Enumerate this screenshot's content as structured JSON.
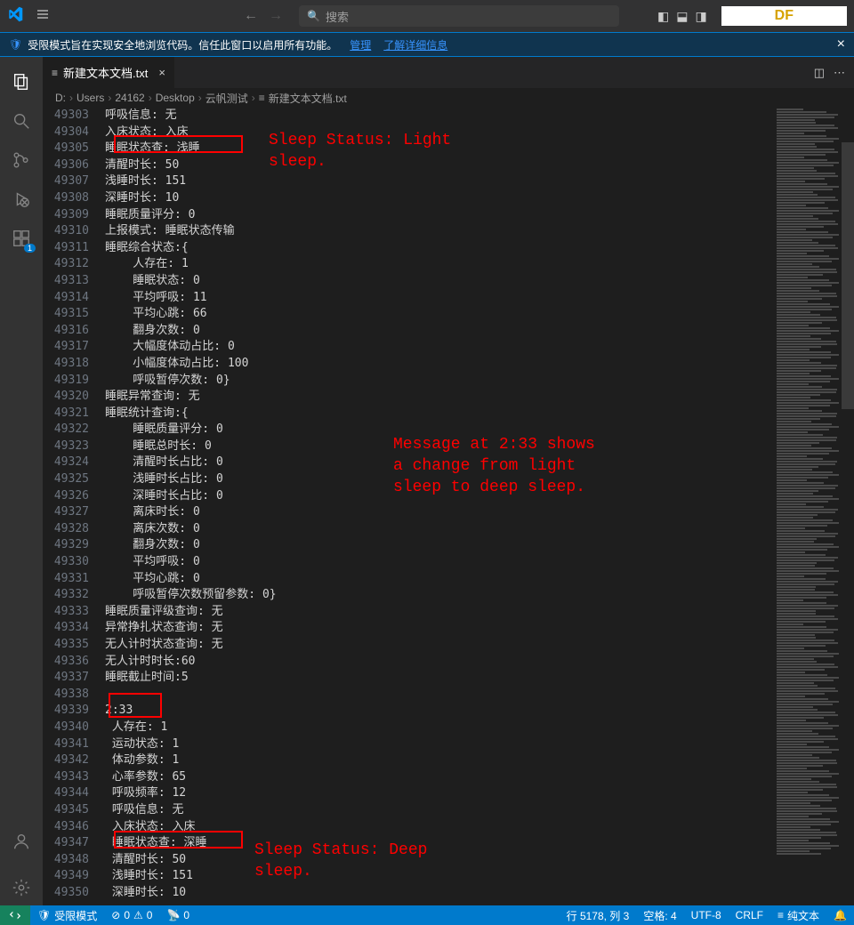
{
  "titlebar": {
    "search_placeholder": "搜索",
    "df_label": "DF"
  },
  "banner": {
    "text": "受限模式旨在实现安全地浏览代码。信任此窗口以启用所有功能。",
    "manage": "管理",
    "learn_more": "了解详细信息"
  },
  "tab": {
    "filename": "新建文本文档.txt"
  },
  "breadcrumbs": [
    "D:",
    "Users",
    "24162",
    "Desktop",
    "云帆测试",
    "新建文本文档.txt"
  ],
  "lines": [
    {
      "n": "49303",
      "t": "呼吸信息: 无"
    },
    {
      "n": "49304",
      "t": "入床状态: 入床"
    },
    {
      "n": "49305",
      "t": "睡眠状态查: 浅睡"
    },
    {
      "n": "49306",
      "t": "清醒时长: 50"
    },
    {
      "n": "49307",
      "t": "浅睡时长: 151"
    },
    {
      "n": "49308",
      "t": "深睡时长: 10"
    },
    {
      "n": "49309",
      "t": "睡眠质量评分: 0"
    },
    {
      "n": "49310",
      "t": "上报模式: 睡眠状态传输"
    },
    {
      "n": "49311",
      "t": "睡眠综合状态:{"
    },
    {
      "n": "49312",
      "t": "    人存在: 1"
    },
    {
      "n": "49313",
      "t": "    睡眠状态: 0"
    },
    {
      "n": "49314",
      "t": "    平均呼吸: 11"
    },
    {
      "n": "49315",
      "t": "    平均心跳: 66"
    },
    {
      "n": "49316",
      "t": "    翻身次数: 0"
    },
    {
      "n": "49317",
      "t": "    大幅度体动占比: 0"
    },
    {
      "n": "49318",
      "t": "    小幅度体动占比: 100"
    },
    {
      "n": "49319",
      "t": "    呼吸暂停次数: 0}"
    },
    {
      "n": "49320",
      "t": "睡眠异常查询: 无"
    },
    {
      "n": "49321",
      "t": "睡眠统计查询:{"
    },
    {
      "n": "49322",
      "t": "    睡眠质量评分: 0"
    },
    {
      "n": "49323",
      "t": "    睡眠总时长: 0"
    },
    {
      "n": "49324",
      "t": "    清醒时长占比: 0"
    },
    {
      "n": "49325",
      "t": "    浅睡时长占比: 0"
    },
    {
      "n": "49326",
      "t": "    深睡时长占比: 0"
    },
    {
      "n": "49327",
      "t": "    离床时长: 0"
    },
    {
      "n": "49328",
      "t": "    离床次数: 0"
    },
    {
      "n": "49329",
      "t": "    翻身次数: 0"
    },
    {
      "n": "49330",
      "t": "    平均呼吸: 0"
    },
    {
      "n": "49331",
      "t": "    平均心跳: 0"
    },
    {
      "n": "49332",
      "t": "    呼吸暂停次数预留参数: 0}"
    },
    {
      "n": "49333",
      "t": "睡眠质量评级查询: 无"
    },
    {
      "n": "49334",
      "t": "异常挣扎状态查询: 无"
    },
    {
      "n": "49335",
      "t": "无人计时状态查询: 无"
    },
    {
      "n": "49336",
      "t": "无人计时时长:60"
    },
    {
      "n": "49337",
      "t": "睡眠截止时间:5"
    },
    {
      "n": "49338",
      "t": ""
    },
    {
      "n": "49339",
      "t": "2:33"
    },
    {
      "n": "49340",
      "t": " 人存在: 1"
    },
    {
      "n": "49341",
      "t": " 运动状态: 1"
    },
    {
      "n": "49342",
      "t": " 体动参数: 1"
    },
    {
      "n": "49343",
      "t": " 心率参数: 65"
    },
    {
      "n": "49344",
      "t": " 呼吸频率: 12"
    },
    {
      "n": "49345",
      "t": " 呼吸信息: 无"
    },
    {
      "n": "49346",
      "t": " 入床状态: 入床"
    },
    {
      "n": "49347",
      "t": " 睡眠状态查: 深睡"
    },
    {
      "n": "49348",
      "t": " 清醒时长: 50"
    },
    {
      "n": "49349",
      "t": " 浅睡时长: 151"
    },
    {
      "n": "49350",
      "t": " 深睡时长: 10"
    }
  ],
  "annotations": {
    "a1": "Sleep Status: Light\nsleep.",
    "a2": "Message at 2:33 shows\na change from light\nsleep to deep sleep.",
    "a3": "Sleep Status: Deep\nsleep."
  },
  "statusbar": {
    "restricted": "受限模式",
    "errors": "0",
    "warnings": "0",
    "port": "0",
    "line_col": "行 5178, 列 3",
    "spaces": "空格: 4",
    "encoding": "UTF-8",
    "eol": "CRLF",
    "lang": "纯文本"
  }
}
